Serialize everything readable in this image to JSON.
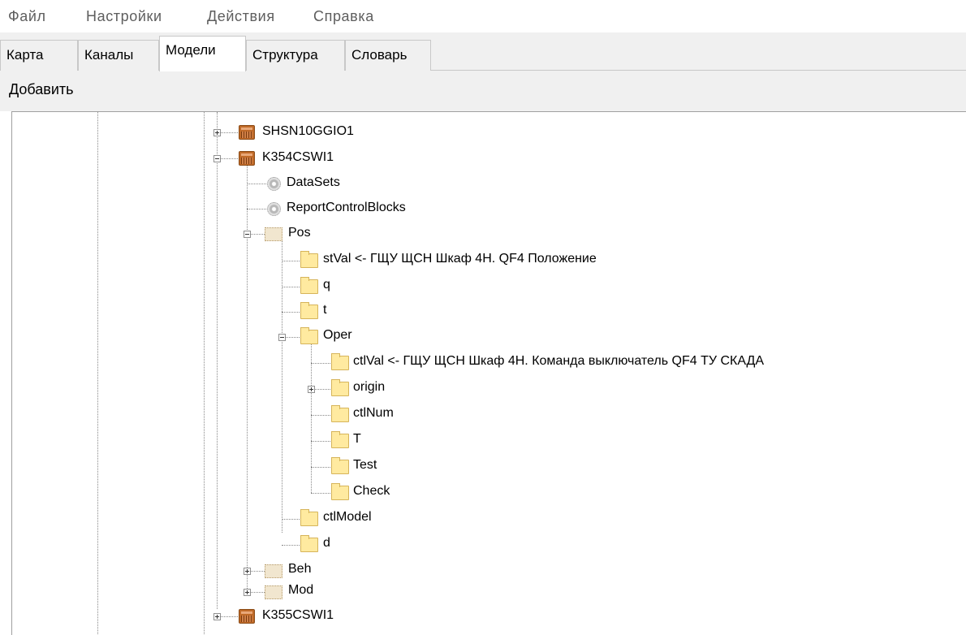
{
  "menu": [
    "Файл",
    "Настройки",
    "Действия",
    "Справка"
  ],
  "tabs": [
    "Карта",
    "Каналы",
    "Модели",
    "Структура",
    "Словарь"
  ],
  "active_tab": "Модели",
  "toolbar": {
    "add_label": "Добавить"
  },
  "tree": {
    "shsn10ggio1": "SHSN10GGIO1",
    "k354cswi1": "K354CSWI1",
    "datasets": "DataSets",
    "reportcontrolblocks": "ReportControlBlocks",
    "pos": "Pos",
    "stval": "stVal <- ГЩУ  ЩСН  Шкаф 4Н. QF4 Положение",
    "q": "q",
    "t": "t",
    "oper": "Oper",
    "ctlval": "ctlVal <- ГЩУ  ЩСН  Шкаф 4Н. Команда выключатель QF4 ТУ СКАДА",
    "origin": "origin",
    "ctlnum": "ctlNum",
    "T": "T",
    "test": "Test",
    "check": "Check",
    "ctlmodel": "ctlModel",
    "d": "d",
    "beh": "Beh",
    "mod": "Mod",
    "k355cswi1": "K355CSWI1"
  }
}
